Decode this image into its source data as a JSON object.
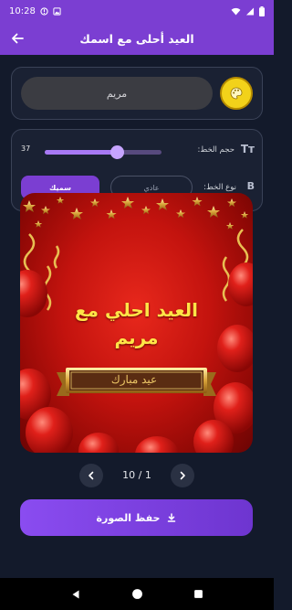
{
  "status_bar": {
    "time": "10:28",
    "notification_icons": [
      "alert-icon",
      "image-icon"
    ],
    "right_icons": [
      "wifi-icon",
      "signal-icon",
      "battery-icon"
    ]
  },
  "app_bar": {
    "title": "العيد أحلى مع اسمك",
    "back_icon": "arrow-left-icon"
  },
  "name_card": {
    "name_value": "مريم",
    "palette_icon": "palette-icon",
    "palette_color": "#f2d21a"
  },
  "font_card": {
    "size_label": "حجم الخط:",
    "size_value": "37",
    "size_slider_fraction": 0.62,
    "size_icon": "Tт",
    "type_label": "نوع الخط:",
    "type_icon": "B",
    "normal_label": "عادي",
    "bold_label": "سميك",
    "selected_type": "bold",
    "accent_color": "#7b3ed2"
  },
  "greeting_image": {
    "line1": "العيد احلي مع",
    "line2": "مريم",
    "banner_text": "عيد مبارك",
    "text_color": "#ffe447"
  },
  "pager": {
    "current": 1,
    "total": 10,
    "label": "10 / 1"
  },
  "save_button": {
    "label": "حفظ الصورة",
    "icon": "download-icon"
  },
  "nav_bar": {
    "icons": [
      "back-triangle-icon",
      "home-circle-icon",
      "recents-square-icon"
    ]
  }
}
